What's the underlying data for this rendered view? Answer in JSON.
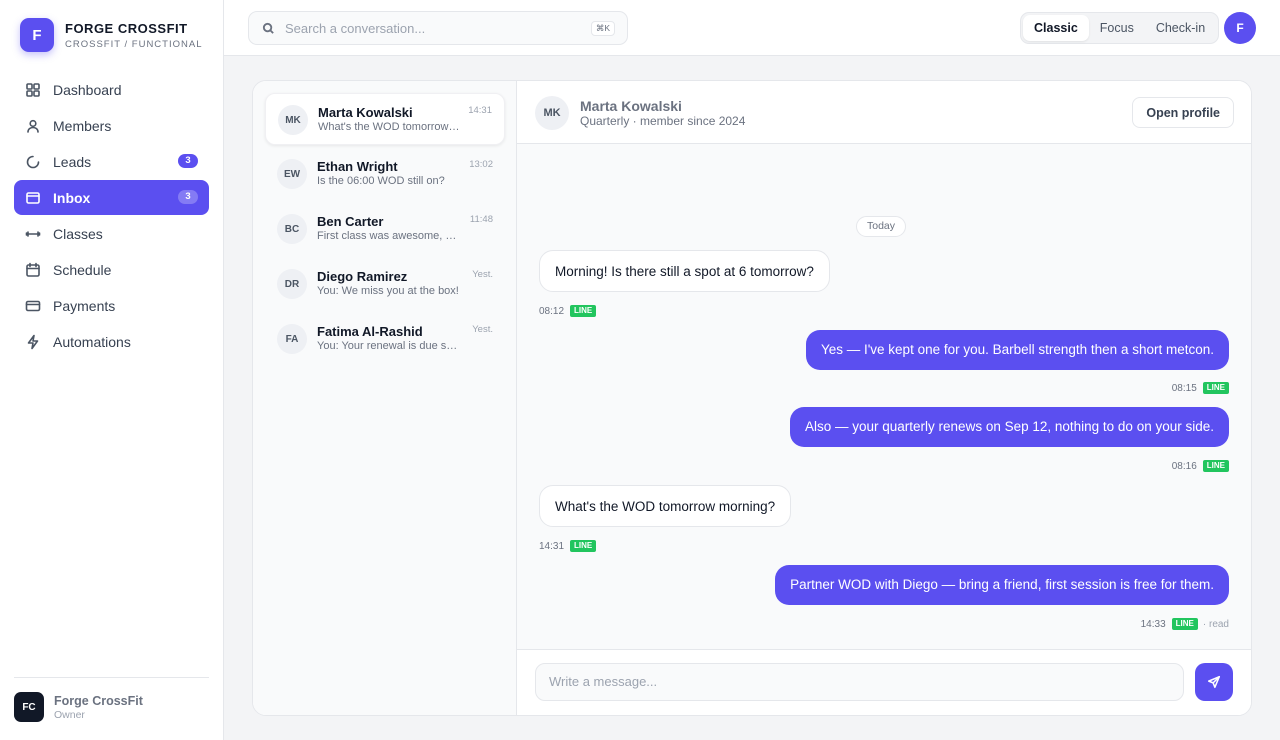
{
  "brand": {
    "logo": "F",
    "name": "FORGE CROSSFIT",
    "subtitle": "CROSSFIT / FUNCTIONAL"
  },
  "nav": [
    {
      "label": "Dashboard",
      "icon": "grid-icon",
      "badge": ""
    },
    {
      "label": "Members",
      "icon": "user-icon",
      "badge": ""
    },
    {
      "label": "Leads",
      "icon": "spinner-icon",
      "badge": "3"
    },
    {
      "label": "Inbox",
      "icon": "inbox-icon",
      "badge": "3",
      "active": true
    },
    {
      "label": "Classes",
      "icon": "dumbbell-icon",
      "badge": ""
    },
    {
      "label": "Schedule",
      "icon": "calendar-icon",
      "badge": ""
    },
    {
      "label": "Payments",
      "icon": "card-icon",
      "badge": ""
    },
    {
      "label": "Automations",
      "icon": "bolt-icon",
      "badge": ""
    }
  ],
  "account": {
    "initials": "FC",
    "name": "Forge CrossFit",
    "role": "Owner"
  },
  "search": {
    "placeholder": "Search a conversation...",
    "shortcut": "⌘K"
  },
  "modes": [
    "Classic",
    "Focus",
    "Check-in"
  ],
  "active_mode": "Classic",
  "user_avatar": "F",
  "conversations": [
    {
      "initials": "MK",
      "name": "Marta Kowalski",
      "time": "14:31",
      "preview": "What's the WOD tomorrow morning?",
      "active": true
    },
    {
      "initials": "EW",
      "name": "Ethan Wright",
      "time": "13:02",
      "preview": "Is the 06:00 WOD still on?"
    },
    {
      "initials": "BC",
      "name": "Ben Carter",
      "time": "11:48",
      "preview": "First class was awesome, thanks!"
    },
    {
      "initials": "DR",
      "name": "Diego Ramirez",
      "time": "Yest.",
      "preview": "You: We miss you at the box!"
    },
    {
      "initials": "FA",
      "name": "Fatima Al-Rashid",
      "time": "Yest.",
      "preview": "You: Your renewal is due soon"
    }
  ],
  "thread": {
    "initials": "MK",
    "name": "Marta Kowalski",
    "meta": "Quarterly · member since 2024",
    "open_profile": "Open profile",
    "day_label": "Today",
    "messages": [
      {
        "dir": "in",
        "text": "Morning! Is there still a spot at 6 tomorrow?",
        "time": "08:12",
        "channel": "LINE",
        "status": ""
      },
      {
        "dir": "out",
        "text": "Yes — I've kept one for you. Barbell strength then a short metcon.",
        "time": "08:15",
        "channel": "LINE",
        "status": ""
      },
      {
        "dir": "out",
        "text": "Also — your quarterly renews on Sep 12, nothing to do on your side.",
        "time": "08:16",
        "channel": "LINE",
        "status": ""
      },
      {
        "dir": "in",
        "text": "What's the WOD tomorrow morning?",
        "time": "14:31",
        "channel": "LINE",
        "status": ""
      },
      {
        "dir": "out",
        "text": "Partner WOD with Diego — bring a friend, first session is free for them.",
        "time": "14:33",
        "channel": "LINE",
        "status": "· read"
      }
    ]
  },
  "composer": {
    "placeholder": "Write a message..."
  },
  "colors": {
    "accent": "#5b4ff0",
    "channel_line": "#22c55e"
  }
}
